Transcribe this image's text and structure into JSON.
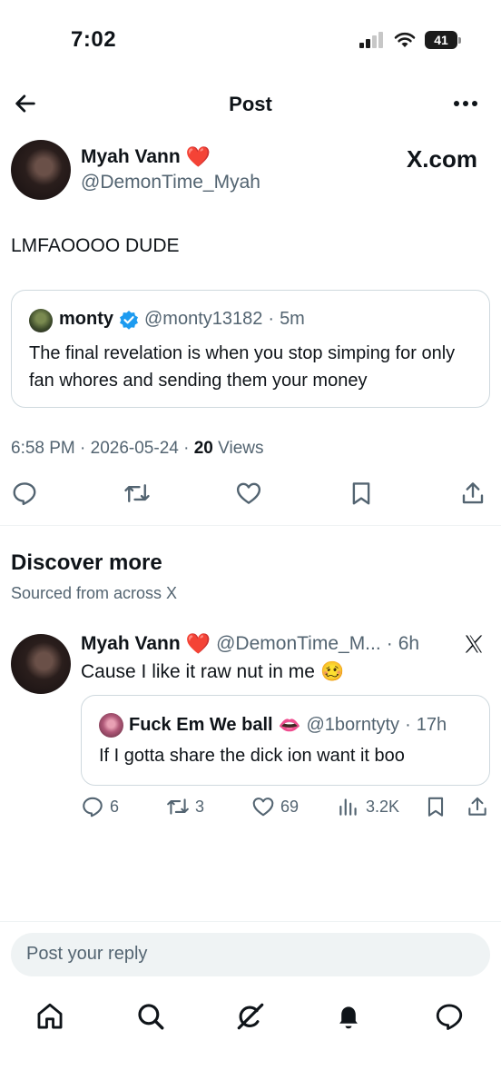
{
  "status_bar": {
    "time": "7:02",
    "battery": "41"
  },
  "header": {
    "title": "Post"
  },
  "post": {
    "author_name": "Myah Vann",
    "author_emoji": "❤️",
    "author_handle": "@DemonTime_Myah",
    "watermark": "X.com",
    "text": "LMFAOOOO DUDE",
    "quote": {
      "name": "monty",
      "handle": "@monty13182",
      "time": "5m",
      "text": "The final revelation is when you stop simping for only fan whores and sending them your money"
    },
    "timestamp": "6:58 PM · 2026-05-24 · ",
    "views_count": "20",
    "views_label": " Views"
  },
  "discover": {
    "title": "Discover more",
    "subtitle": "Sourced from across X",
    "tweet": {
      "name": "Myah Vann",
      "emoji": "❤️",
      "handle": "@DemonTime_M...",
      "time": "6h",
      "text": "Cause I like it raw nut in me",
      "text_emoji": "🥴",
      "quote": {
        "name": "Fuck Em We ball",
        "emoji": "👄",
        "handle": "@1borntyty",
        "time": "17h",
        "text": "If I gotta share the dick ion want it boo"
      },
      "replies": "6",
      "retweets": "3",
      "likes": "69",
      "views": "3.2K"
    }
  },
  "reply": {
    "placeholder": "Post your reply"
  },
  "colors": {
    "text": "#0f1419",
    "secondary": "#536471",
    "border": "#cfd9de",
    "verified": "#1d9bf0",
    "heart": "#e0245e"
  },
  "icons": [
    "back-arrow-icon",
    "more-icon",
    "verified-icon",
    "reply-icon",
    "retweet-icon",
    "like-icon",
    "bookmark-icon",
    "share-icon",
    "views-icon",
    "x-logo-icon",
    "home-icon",
    "search-icon",
    "grok-icon",
    "notifications-icon",
    "messages-icon"
  ]
}
